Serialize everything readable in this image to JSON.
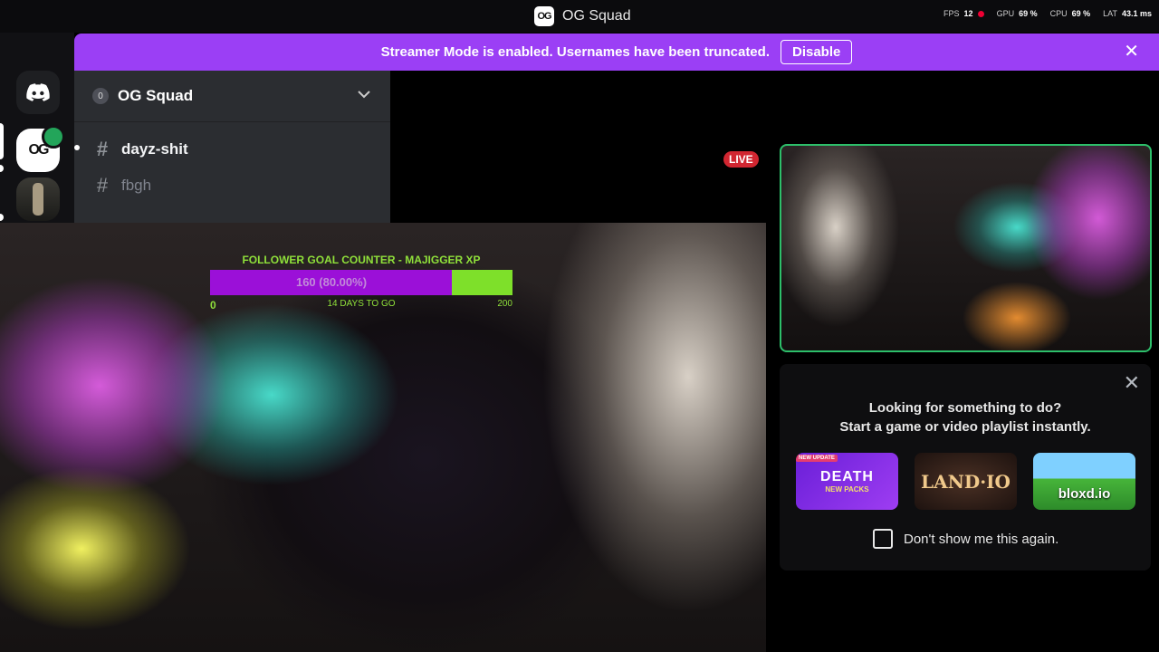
{
  "titlebar": {
    "logo_text": "OG",
    "title": "OG Squad",
    "stats": [
      {
        "label": "FPS",
        "value": "12"
      },
      {
        "label": "GPU",
        "value": "69 %"
      },
      {
        "label": "CPU",
        "value": "69 %"
      },
      {
        "label": "LAT",
        "value": "43.1 ms"
      }
    ]
  },
  "rail": {
    "servers": [
      {
        "name": "discord-home"
      },
      {
        "name": "og-squad",
        "text": "OG"
      },
      {
        "name": "soldier-server"
      },
      {
        "name": "green-server"
      }
    ]
  },
  "banner": {
    "message": "Streamer Mode is enabled. Usernames have been truncated.",
    "disable_label": "Disable",
    "close_glyph": "✕"
  },
  "sidebar": {
    "guild_badge": "0",
    "guild_name": "OG Squad",
    "chevron": "⌄",
    "channels": [
      {
        "name": "dayz-shit",
        "unread": true
      },
      {
        "name": "fbgh",
        "unread": false
      }
    ]
  },
  "stream": {
    "goal_title": "FOLLOWER GOAL COUNTER - MAJIGGER XP",
    "goal_current": 160,
    "goal_target": 200,
    "goal_text": "160 (80.00%)",
    "goal_fraction": 0.8,
    "goal_min": "0",
    "goal_days": "14 DAYS TO GO",
    "goal_max": "200",
    "colors": {
      "bar_fill": "#9b10d8",
      "bar_bg": "#7ee02a",
      "text": "#8fe03a"
    }
  },
  "live_badge": "LIVE",
  "activity": {
    "close_glyph": "✕",
    "line1": "Looking for something to do?",
    "line2": "Start a game or video playlist instantly.",
    "tiles": [
      {
        "name": "death-by-ai",
        "title": "DEATH",
        "subtitle": "NEW PACKS",
        "tag": "NEW UPDATE"
      },
      {
        "name": "land-io",
        "title": "LAND·IO"
      },
      {
        "name": "bloxd-io",
        "title": "bloxd.io"
      }
    ],
    "dont_show_label": "Don't show me this again."
  }
}
